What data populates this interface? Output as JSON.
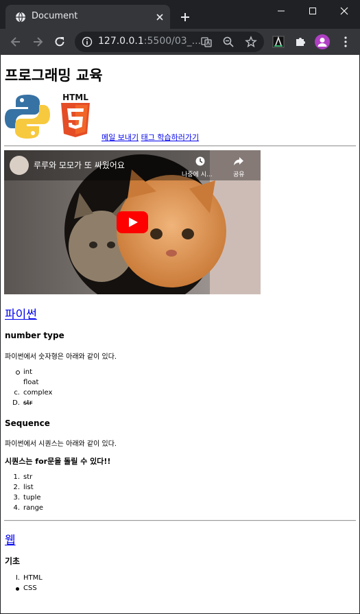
{
  "browser": {
    "tab_title": "Document",
    "url_host": "127.0.0.1",
    "url_rest": ":5500/03_..."
  },
  "page": {
    "title": "프로그래밍 교육",
    "links": {
      "mail": "메일 보내기",
      "tag": "태그 학습하러가기"
    },
    "video": {
      "title": "루루와 모모가 또 싸웠어요",
      "watch_later": "나중에 시...",
      "share": "공유"
    },
    "python": {
      "heading": "파이썬",
      "number_type": {
        "heading": "number type",
        "desc": "파이썬에서 숫자형은 아래와 같이 있다.",
        "items": [
          {
            "marker": "circle",
            "text": "int"
          },
          {
            "marker": "",
            "text": "float"
          },
          {
            "marker": "c.",
            "text": "complex"
          },
          {
            "marker": "D.",
            "text": "str"
          }
        ]
      },
      "sequence": {
        "heading": "Sequence",
        "desc": "파이썬에서 시퀀스는 아래와 같이 있다.",
        "note": "시퀀스는 for문을 돌릴 수 있다!!",
        "items": [
          {
            "marker": "1.",
            "text": "str"
          },
          {
            "marker": "2.",
            "text": "list"
          },
          {
            "marker": "3.",
            "text": "tuple"
          },
          {
            "marker": "4.",
            "text": "range"
          }
        ]
      }
    },
    "web": {
      "heading": "웹",
      "basics_heading": "기초",
      "items": [
        {
          "marker": "I.",
          "text": "HTML"
        },
        {
          "marker": "disc",
          "text": "CSS"
        }
      ]
    }
  },
  "colors": {
    "link": "#0000ee",
    "chrome_dark": "#202124",
    "chrome_toolbar": "#35363a",
    "youtube_red": "#ff0000"
  }
}
